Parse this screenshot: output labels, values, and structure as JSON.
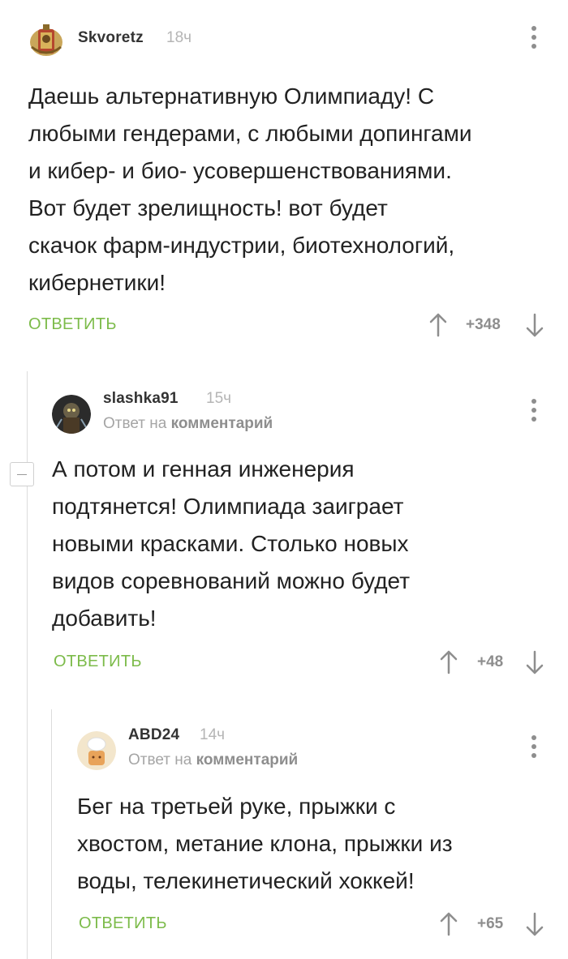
{
  "comments": [
    {
      "username": "Skvoretz",
      "time": "18ч",
      "text_lines": [
        "Даешь альтернативную Олимпиаду! С",
        "любыми гендерами, с любыми допингами",
        "и кибер- и био- усовершенствованиями.",
        "Вот будет зрелищность! вот будет",
        "скачок фарм-индустрии, биотехнологий,",
        "кибернетики!"
      ],
      "reply_label": "ОТВЕТИТЬ",
      "rating": "+348"
    },
    {
      "username": "slashka91",
      "time": "15ч",
      "reply_prefix": "Ответ на",
      "reply_target": "комментарий",
      "text_lines": [
        "А потом и генная инженерия",
        "подтянется! Олимпиада заиграет",
        "новыми красками. Столько новых",
        "видов соревнований можно будет",
        "добавить!"
      ],
      "reply_label": "ОТВЕТИТЬ",
      "rating": "+48"
    },
    {
      "username": "ABD24",
      "time": "14ч",
      "reply_prefix": "Ответ на",
      "reply_target": "комментарий",
      "text_lines": [
        "Бег на третьей руке, прыжки с",
        "хвостом, метание клона, прыжки из",
        "воды, телекинетический хоккей!"
      ],
      "reply_label": "ОТВЕТИТЬ",
      "rating": "+65"
    }
  ],
  "colors": {
    "reply_green": "#7cbb4a",
    "muted": "#a5a5a5",
    "thread_line": "#dcdcdc"
  },
  "icons": [
    "emblem-avatar",
    "portrait-avatar",
    "chef-avatar",
    "more-vertical-icon",
    "arrow-up-icon",
    "arrow-down-icon",
    "collapse-minus-icon"
  ]
}
